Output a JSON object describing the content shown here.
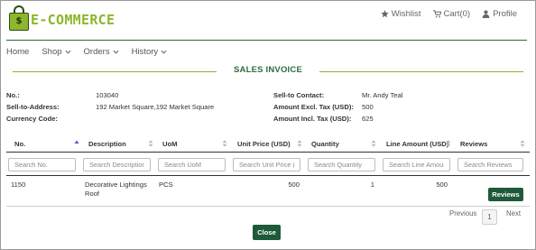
{
  "brand": {
    "logo_text": "E-COMMERCE",
    "logo_mark": "$"
  },
  "topnav": {
    "wishlist": "Wishlist",
    "cart": "Cart(0)",
    "profile": "Profile"
  },
  "menu": [
    {
      "label": "Home",
      "has_dropdown": false
    },
    {
      "label": "Shop",
      "has_dropdown": true
    },
    {
      "label": "Orders",
      "has_dropdown": true
    },
    {
      "label": "History",
      "has_dropdown": true
    }
  ],
  "page_title": "SALES INVOICE",
  "invoice": {
    "no_label": "No.:",
    "no_value": "103040",
    "sell_to_address_label": "Sell-to-Address:",
    "sell_to_address_value": "192 Market Square,192 Market Square",
    "currency_label": "Currency Code:",
    "currency_value": "",
    "sell_to_contact_label": "Sell-to Contact:",
    "sell_to_contact_value": "Mr. Andy Teal",
    "excl_tax_label": "Amount Excl. Tax (USD):",
    "excl_tax_value": "500",
    "incl_tax_label": "Amount Incl. Tax (USD):",
    "incl_tax_value": "625"
  },
  "table": {
    "columns": [
      "No.",
      "Description",
      "UoM",
      "Unit Price (USD)",
      "Quantity",
      "Line Amount (USD)",
      "Reviews"
    ],
    "filters": [
      "Search No.",
      "Search Description",
      "Search UoM",
      "Search Unit Price (USD)",
      "Search Quantity",
      "Search Line Amount (USD)",
      "Search Reviews"
    ],
    "rows": [
      {
        "no": "1150",
        "description": "Decorative Lightings Roof",
        "uom": "PCS",
        "unit_price": "500",
        "quantity": "1",
        "line_amount": "500",
        "reviews_button": "Reviews"
      }
    ]
  },
  "pagination": {
    "previous": "Previous",
    "current_page": "1",
    "next": "Next"
  },
  "close_button": "Close",
  "colors": {
    "brand_green": "#8cb62d",
    "dark_green": "#1e5a3a",
    "title_green": "#2e6b40"
  }
}
